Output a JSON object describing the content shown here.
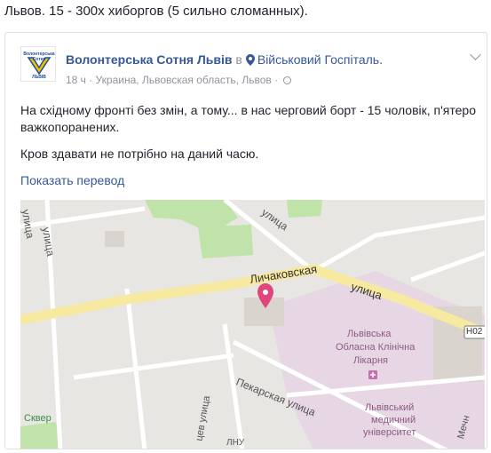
{
  "headline": "Львов. 15 - 300х хиборгов (5 сильно сломанных).",
  "post": {
    "author": "Волонтерська Сотня Львів",
    "in_word": "в",
    "place": "Військовий Госпіталь.",
    "meta": "18 ч · Украина, Львовская область, Львов ·",
    "avatar_text": [
      "Волонтерська",
      "Сотня",
      "ЛЬВІВ"
    ],
    "text_lines": [
      "На східному фронті без змін, а тому... в нас черговий борт - 15 чоловік, п'ятеро важкопоранених.",
      "Кров здавати не потрібно на даний часю."
    ],
    "translate_link": "Показать перевод"
  },
  "map": {
    "labels": {
      "lychakivska": "Личаковская",
      "ulitsa_main": "улица",
      "ulitsa_top": "улица",
      "pekarska": "Пекарская улица",
      "ulitsa_left": "улица",
      "hospital_1": "Львівська",
      "hospital_2": "Обласна Клінічна",
      "hospital_3": "Лікарня",
      "uni_1": "Львівський",
      "uni_2": "медичний",
      "uni_3": "університет",
      "skver": "Сквер",
      "road_code": "Н02",
      "mechn": "Мечн",
      "tsev": "цев улица",
      "lnu": "ЛНУ",
      "left_vert": "улица"
    },
    "colors": {
      "background": "#e8e6e2",
      "road": "#ffffff",
      "main_road": "#f7e9a0",
      "park": "#bfe3a8",
      "hospital_area": "#e7d7e5",
      "pin": "#e0457b"
    }
  }
}
